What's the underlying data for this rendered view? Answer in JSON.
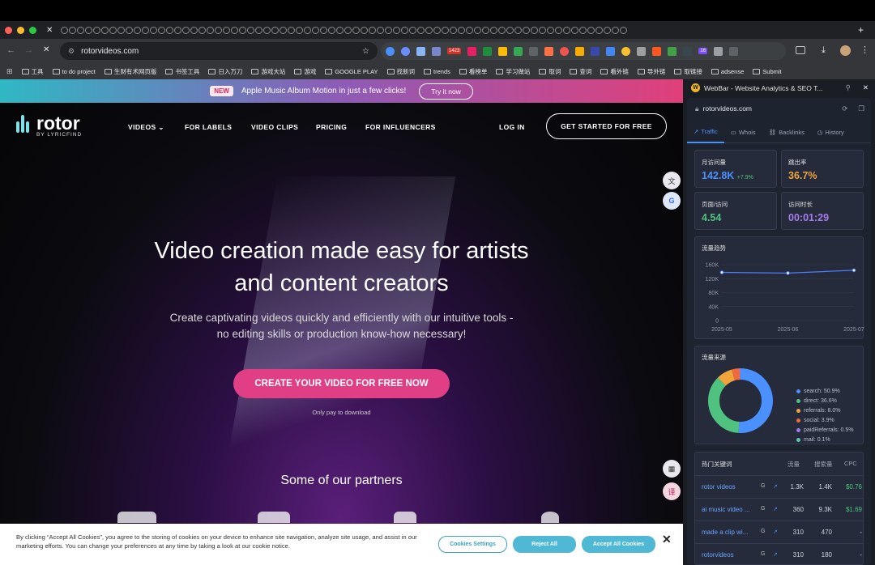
{
  "browser": {
    "url": "rotorvideos.com",
    "bookmarks": [
      "工具",
      "to do project",
      "生财有术网页版",
      "书签工具",
      "日入万刀",
      "游戏大站",
      "游戏",
      "GOOGLE PLAY",
      "找新词",
      "trends",
      "看榜单",
      "学习做站",
      "取词",
      "查词",
      "看外链",
      "导外链",
      "取链接",
      "adsense",
      "Submit"
    ],
    "extension_badges": {
      "count_1": "1423",
      "count_2": "16"
    }
  },
  "site": {
    "announcement": {
      "badge": "NEW",
      "text": "Apple Music Album Motion in just a few clicks!",
      "button": "Try it now"
    },
    "logo": {
      "name": "rotor",
      "sub": "BY LYRICFIND"
    },
    "nav": {
      "videos": "VIDEOS",
      "labels": "FOR  LABELS",
      "clips": "VIDEO CLIPS",
      "pricing": "PRICING",
      "influencers": "FOR  INFLUENCERS",
      "login": "LOG IN",
      "get_started": "GET STARTED FOR FREE"
    },
    "hero": {
      "title_line1": "Video creation made easy for artists",
      "title_line2": "and content creators",
      "sub_line1": "Create captivating videos quickly and efficiently with our intuitive tools -",
      "sub_line2": "no editing skills or production know-how necessary!",
      "cta": "CREATE YOUR VIDEO FOR FREE NOW",
      "note": "Only pay to download"
    },
    "partners_title": "Some of our partners",
    "cookie": {
      "text": "By clicking “Accept All Cookies”, you agree to the storing of cookies on your device to enhance site navigation, analyze site usage, and assist in our marketing efforts. You can change your preferences at any time by taking a look at our cookie notice.",
      "settings": "Cookies Settings",
      "reject": "Reject All",
      "accept": "Accept All Cookies",
      "close": "✕"
    }
  },
  "webbar": {
    "title": "WebBar - Website Analytics & SEO T...",
    "domain": "rotorvideos.com",
    "tabs": [
      "Traffic",
      "Whois",
      "Backlinks",
      "History"
    ],
    "stats": {
      "visits_label": "月访问量",
      "visits": "142.8K",
      "visits_change": "+7.9%",
      "bounce_label": "跳出率",
      "bounce": "36.7%",
      "pages_label": "页面/访问",
      "pages": "4.54",
      "duration_label": "访问时长",
      "duration": "00:01:29"
    },
    "trend_title": "流量趋势",
    "sources_title": "流量来源",
    "sources_legend": [
      "search: 50.9%",
      "direct: 36.6%",
      "referrals: 8.0%",
      "social: 3.9%",
      "paidReferrals: 0.5%",
      "mail: 0.1%"
    ],
    "keywords": {
      "title": "热门关键词",
      "col_traffic": "流量",
      "col_volume": "搜索量",
      "col_cpc": "CPC",
      "rows": [
        {
          "kw": "rotor videos",
          "traffic": "1.3K",
          "volume": "1.4K",
          "cpc": "$0.76"
        },
        {
          "kw": "ai music video ...",
          "traffic": "360",
          "volume": "9.3K",
          "cpc": "$1.69"
        },
        {
          "kw": "made a clip wi...",
          "traffic": "310",
          "volume": "470",
          "cpc": "-"
        },
        {
          "kw": "rotorvideos",
          "traffic": "310",
          "volume": "180",
          "cpc": "-"
        }
      ]
    }
  },
  "chart_data": [
    {
      "type": "line",
      "title": "流量趋势",
      "categories": [
        "2025-05",
        "2025-06",
        "2025-07"
      ],
      "series": [
        {
          "values": [
            138000,
            136000,
            144000
          ]
        }
      ],
      "ylim": [
        0,
        160000
      ],
      "yticks": [
        "0",
        "40K",
        "80K",
        "120K",
        "160K"
      ],
      "grid": true,
      "color": "#4a7dff"
    },
    {
      "type": "pie",
      "title": "流量来源",
      "labels": [
        "search",
        "direct",
        "referrals",
        "social",
        "paidReferrals",
        "mail"
      ],
      "values": [
        50.9,
        36.6,
        8.0,
        3.9,
        0.5,
        0.1
      ],
      "colors": [
        "#4a90ff",
        "#4ec27e",
        "#f0a43c",
        "#f06a3c",
        "#9b7bea",
        "#5ec7a8"
      ],
      "legend": "right"
    }
  ]
}
